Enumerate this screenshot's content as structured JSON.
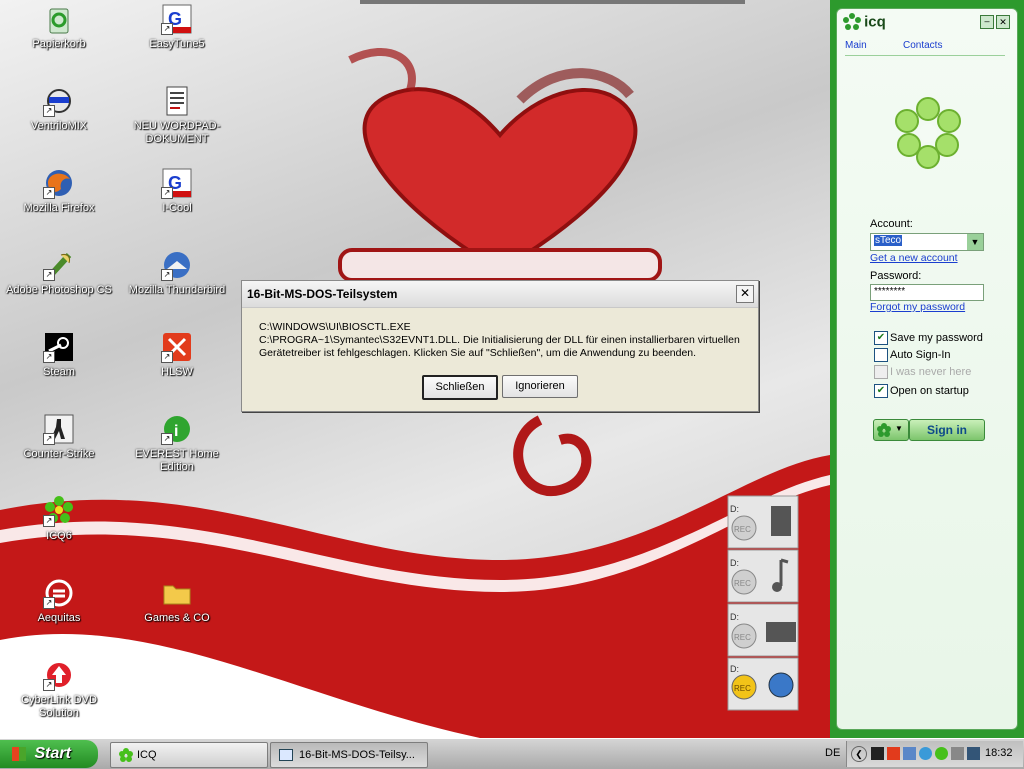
{
  "desktop": {
    "icons": [
      {
        "id": "papierkorb",
        "label": "Papierkorb"
      },
      {
        "id": "easytune5",
        "label": "EasyTune5"
      },
      {
        "id": "ventrilomix",
        "label": "VentriloMIX"
      },
      {
        "id": "wordpad",
        "label": "NEU WORDPAD-DOKUMENT"
      },
      {
        "id": "firefox",
        "label": "Mozilla Firefox"
      },
      {
        "id": "icool",
        "label": "I-Cool"
      },
      {
        "id": "photoshop",
        "label": "Adobe Photoshop CS"
      },
      {
        "id": "thunderbird",
        "label": "Mozilla Thunderbird"
      },
      {
        "id": "steam",
        "label": "Steam"
      },
      {
        "id": "hlsw",
        "label": "HLSW"
      },
      {
        "id": "counterstrike",
        "label": "Counter-Strike"
      },
      {
        "id": "everest",
        "label": "EVEREST Home Edition"
      },
      {
        "id": "icq6",
        "label": "ICQ6"
      },
      {
        "id": "aequitas",
        "label": "Aequitas"
      },
      {
        "id": "games",
        "label": "Games & CO"
      },
      {
        "id": "cyberlink",
        "label": "CyberLink DVD Solution"
      }
    ],
    "rec_widget": {
      "drive_label": "D:",
      "rec_label": "REC"
    }
  },
  "dialog": {
    "title": "16-Bit-MS-DOS-Teilsystem",
    "close": "✕",
    "line1": "C:\\WINDOWS\\UI\\BIOSCTL.EXE",
    "line2": "C:\\PROGRA~1\\Symantec\\S32EVNT1.DLL. Die Initialisierung der DLL für einen installierbaren virtuellen Gerätetreiber ist fehlgeschlagen. Klicken Sie auf \"Schließen\", um die Anwendung zu beenden.",
    "btn_close": "Schließen",
    "btn_ignore": "Ignorieren"
  },
  "icq": {
    "logo": "icq",
    "tab_main": "Main",
    "tab_contacts": "Contacts",
    "account_label": "Account:",
    "account_value": "sTeco",
    "new_account_link": "Get a new account",
    "password_label": "Password:",
    "password_value": "********",
    "forgot_link": "Forgot my password",
    "opt_save": "Save my password",
    "opt_auto": "Auto Sign-In",
    "opt_never": "I was never here",
    "opt_startup": "Open on startup",
    "signin": "Sign in",
    "accent": "#2d9a2d"
  },
  "taskbar": {
    "start": "Start",
    "tasks": [
      {
        "label": "ICQ"
      },
      {
        "label": "16-Bit-MS-DOS-Teilsy..."
      }
    ],
    "language": "DE",
    "clock": "18:32"
  }
}
